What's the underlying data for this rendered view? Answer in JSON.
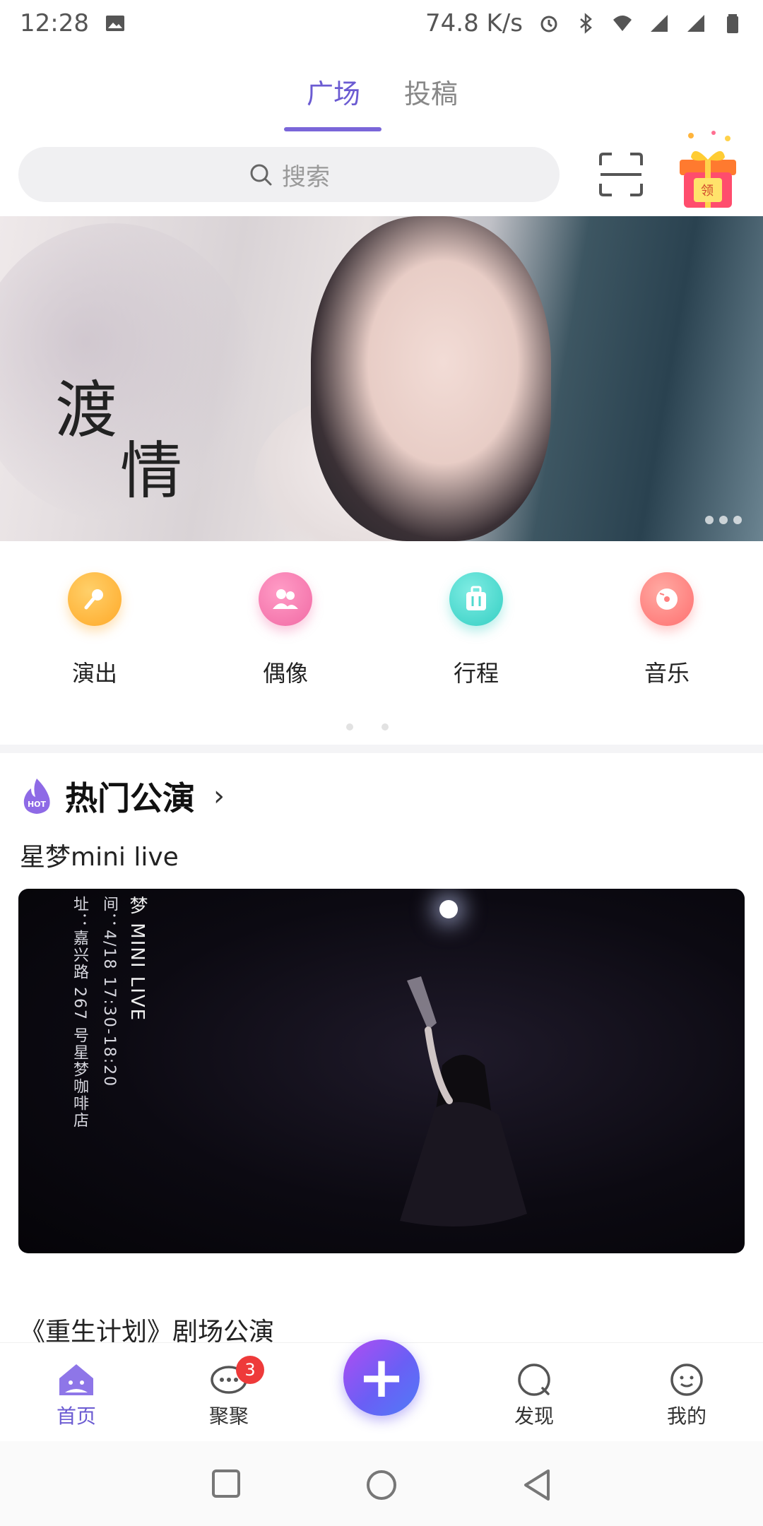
{
  "status_bar": {
    "time": "12:28",
    "network_speed": "74.8 K/s",
    "icons": [
      "image-icon",
      "alarm-icon",
      "bluetooth-icon",
      "wifi-icon",
      "signal-icon",
      "signal-icon",
      "battery-icon"
    ]
  },
  "top_tabs": [
    {
      "label": "广场",
      "active": true
    },
    {
      "label": "投稿",
      "active": false
    }
  ],
  "search": {
    "placeholder": "搜索"
  },
  "gift_badge": "领",
  "banner": {
    "text_line1": "渡",
    "text_line2": "情"
  },
  "categories": [
    {
      "label": "演出",
      "icon": "microphone-icon",
      "color": "#ffb341"
    },
    {
      "label": "偶像",
      "icon": "idol-icon",
      "color": "#f37fb0"
    },
    {
      "label": "行程",
      "icon": "luggage-icon",
      "color": "#4fd9cf"
    },
    {
      "label": "音乐",
      "icon": "disc-icon",
      "color": "#ff7f7f"
    }
  ],
  "hot_section": {
    "badge": "HOT",
    "title": "热门公演",
    "items": [
      {
        "title": "星梦mini live",
        "poster_text": {
          "col1": "址：嘉兴路 267 号星梦咖啡店",
          "col2": "间：4/18 17:30-18:20",
          "col3": "梦 MINI LIVE"
        }
      },
      {
        "title": "《重生计划》剧场公演"
      }
    ]
  },
  "bottom_nav": [
    {
      "label": "首页",
      "active": true,
      "icon": "home-icon"
    },
    {
      "label": "聚聚",
      "active": false,
      "icon": "chat-icon",
      "badge": "3"
    },
    {
      "label": "发现",
      "active": false,
      "icon": "discover-icon"
    },
    {
      "label": "我的",
      "active": false,
      "icon": "profile-icon"
    }
  ],
  "fab": {
    "label": "+"
  },
  "colors": {
    "accent": "#6b5bd2",
    "badge": "#ee3a3a"
  }
}
